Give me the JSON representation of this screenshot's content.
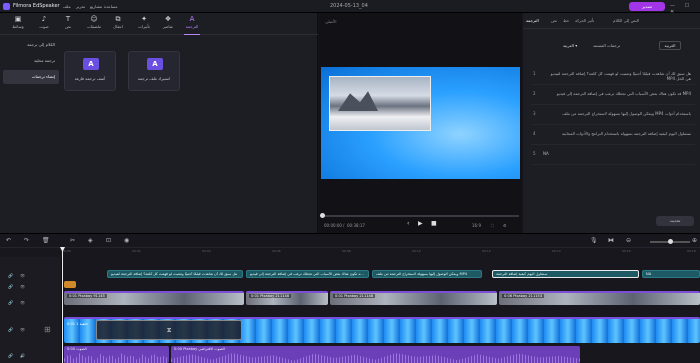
{
  "app": {
    "name": "Filmora EdSpeaker",
    "doc_title": "2024-05-13_04",
    "menu": [
      "ملف",
      "تحرير",
      "مشاريع",
      "مساعدة"
    ],
    "export_label": "تصدير",
    "window_buttons": "— ☐ ✕"
  },
  "toolbar": {
    "tools": [
      {
        "label": "وسائط",
        "icon": "media-icon"
      },
      {
        "label": "صوت",
        "icon": "audio-icon"
      },
      {
        "label": "نص",
        "icon": "text-icon"
      },
      {
        "label": "ملصقات",
        "icon": "stickers-icon"
      },
      {
        "label": "انتقال",
        "icon": "transition-icon"
      },
      {
        "label": "تأثيرات",
        "icon": "effects-icon"
      },
      {
        "label": "عناصر",
        "icon": "elements-icon"
      },
      {
        "label": "الترجمة",
        "icon": "subtitle-icon"
      }
    ],
    "active_index": 7
  },
  "sidebar": {
    "items": [
      "الكلام إلى ترجمة",
      "ترجمة محلية",
      "إنشاء ترجمات"
    ],
    "active_index": 2
  },
  "templates": [
    {
      "label": "أضف ترجمة فارغة"
    },
    {
      "label": "استيراد ملف ترجمة"
    }
  ],
  "preview": {
    "ratio_label": "الأصلي",
    "current_time": "00:00:00",
    "total_time": "00:38:17",
    "aspect": "16:9"
  },
  "right_panel": {
    "tabs": [
      "الترجمة",
      "نص",
      "خط",
      "تأثير الحركة",
      "النص إلى الكلام"
    ],
    "active_tab": 0,
    "language_button": "العربية",
    "language_label": "ترجمات المستند",
    "language_dropdown": "العربية ▾",
    "subtitles": [
      {
        "num": "1",
        "text": "هل سبق لك أن شاهدت فيلمًا أجنبيًا وتمنيت لو فهمت كل كلمة؟ إضافة الترجمة لفيديو MP4 هي الحل"
      },
      {
        "num": "2",
        "text": "قد تكون هناك بعض الأسباب التي تجعلك ترغب في إضافة الترجمة إلى فيديو MP4"
      },
      {
        "num": "3",
        "text": "ويمكن الوصول إليها بسهولة لاستخراج الترجمة من ملف MP4 باستخدام أدوات"
      },
      {
        "num": "4",
        "text": "سنتناول اليوم كيفية إضافة الترجمة بسهولة باستخدام البرامج والأدوات المجانية"
      },
      {
        "num": "5",
        "text": "NA"
      }
    ],
    "generate_button": "تحديث"
  },
  "timeline": {
    "ruler": [
      "00:00",
      "00:02",
      "00:04",
      "00:06",
      "00:08",
      "00:10",
      "00:12",
      "00:14",
      "00:16",
      "00:18"
    ],
    "subtitle_clips": [
      "هل سبق لك أن شاهدت فيلمًا أجنبيًا وتمنيت لو فهمت كل كلمة؟ إضافة الترجمة لفيديو",
      "قد تكون هناك بعض الأسباب التي تجعلك ترغب في إضافة الترجمة إلى فيديو MP4",
      "ويمكن الوصول إليها بسهولة لاستخراج الترجمة من ملف MP4",
      "سنتناول اليوم كيفية إضافة الترجمة",
      "NA"
    ],
    "video_clips": [
      "0:01 Pixabay 91145",
      "0:01 Pixabay 211148",
      "0:01 Pixabay 211148",
      "0:06 Pixabay 211153"
    ],
    "bg_clip": "خلفية 1 0:01",
    "audio_clips": [
      "الصوت 0:00",
      "0:00 Pixabay الصوت الافتراضي"
    ]
  }
}
